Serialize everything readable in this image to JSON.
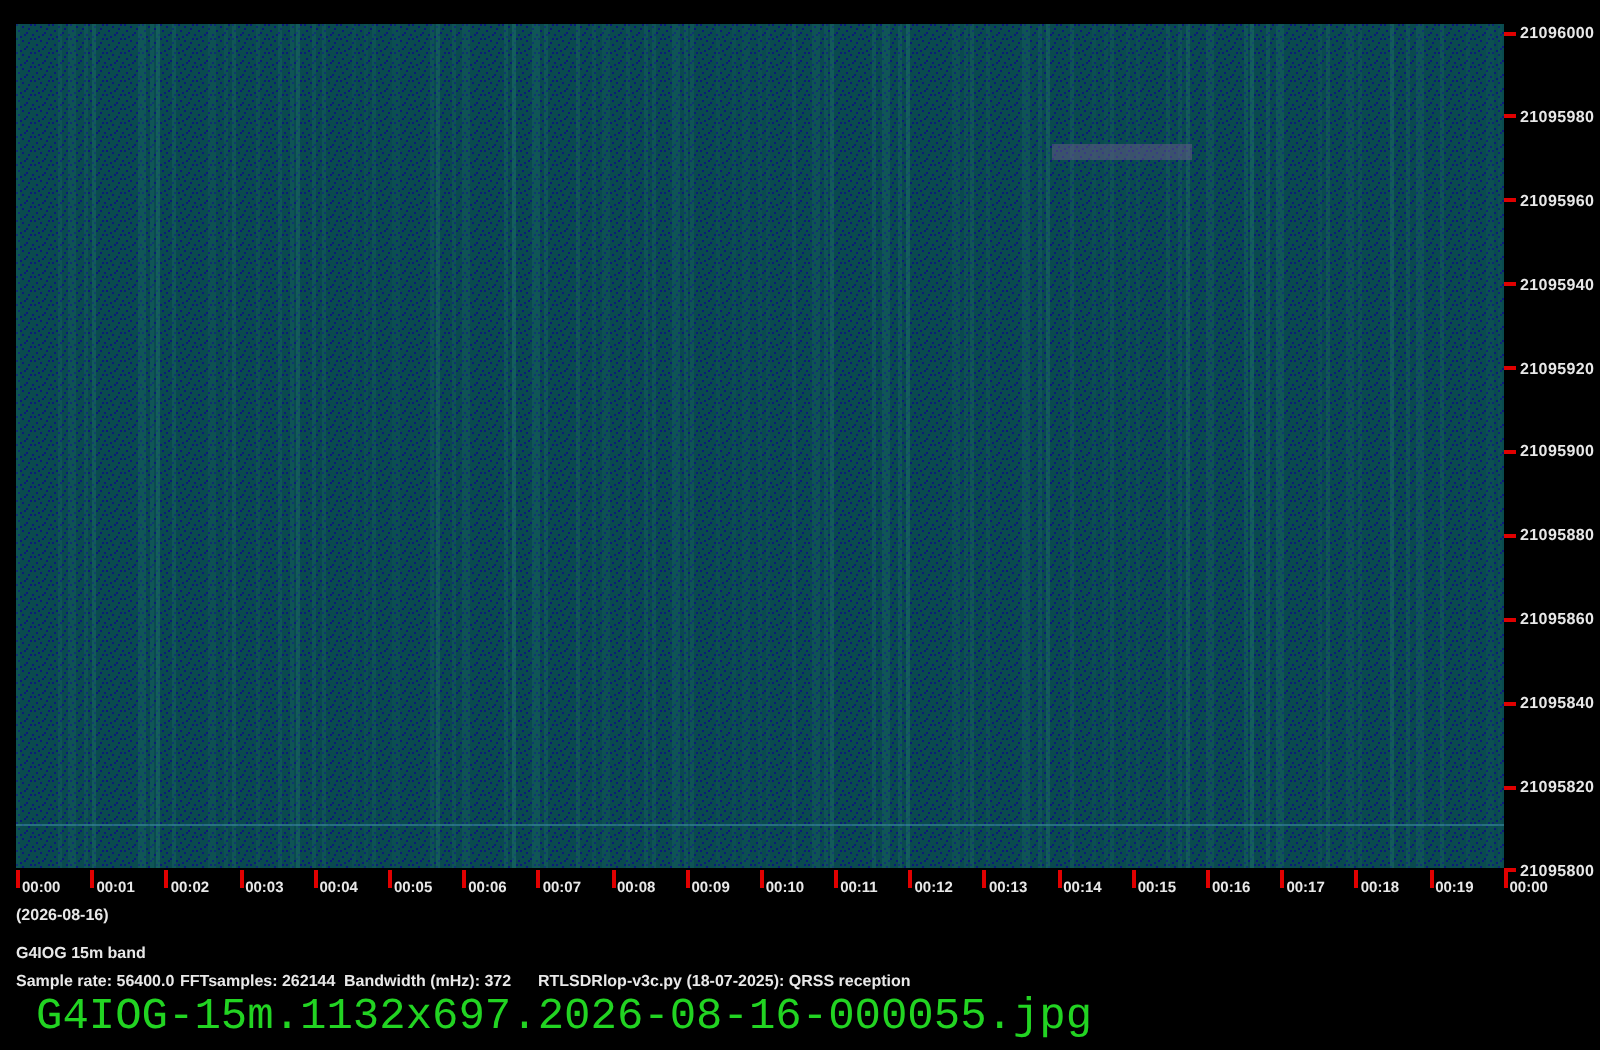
{
  "waterfall": {
    "frequency_labels": [
      "21096000",
      "21095980",
      "21095960",
      "21095940",
      "21095920",
      "21095900",
      "21095880",
      "21095860",
      "21095840",
      "21095820",
      "21095800"
    ],
    "time_labels": [
      "00:00",
      "00:01",
      "00:02",
      "00:03",
      "00:04",
      "00:05",
      "00:06",
      "00:07",
      "00:08",
      "00:09",
      "00:10",
      "00:11",
      "00:12",
      "00:13",
      "00:14",
      "00:15",
      "00:16",
      "00:17",
      "00:18",
      "00:19",
      "00:00"
    ],
    "date": "(2026-08-16)"
  },
  "caption": {
    "station": "G4IOG 15m band",
    "details": [
      "Sample rate: 56400.0",
      "FFTsamples: 262144",
      "Bandwidth (mHz): 372",
      "RTLSDRlop-v3c.py (18-07-2025): QRSS reception"
    ]
  },
  "filename": "G4IOG-15m.1132x697.2026-08-16-000055.jpg"
}
